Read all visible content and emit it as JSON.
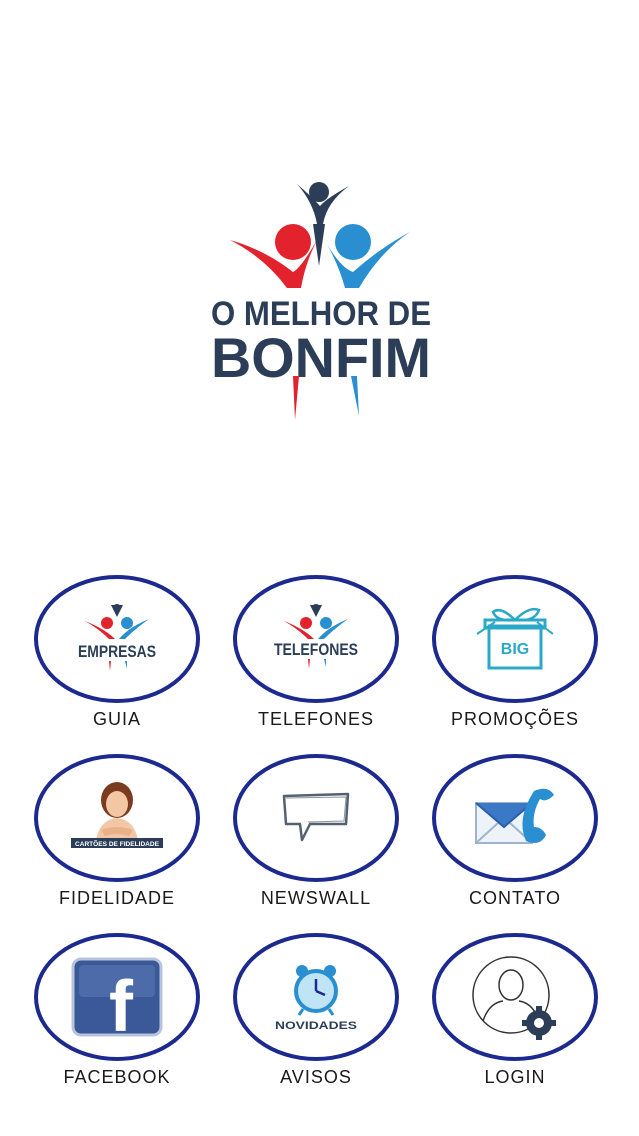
{
  "logo": {
    "line1": "O MELHOR DE",
    "line2": "BONFIM",
    "colors": {
      "red": "#e2232e",
      "blue": "#2a8fd0",
      "navy": "#2c3e57"
    }
  },
  "menu": {
    "accent": "#1c2a8f",
    "items": [
      {
        "label": "GUIA",
        "icon": "empresas-icon",
        "icon_text": "EMPRESAS"
      },
      {
        "label": "TELEFONES",
        "icon": "telefones-icon",
        "icon_text": "TELEFONES"
      },
      {
        "label": "PROMOÇÕES",
        "icon": "gift-box-icon",
        "icon_text": "BIG"
      },
      {
        "label": "FIDELIDADE",
        "icon": "loyalty-card-icon",
        "icon_text": "CARTÕES DE FIDELIDADE"
      },
      {
        "label": "NEWSWALL",
        "icon": "speech-bubble-icon"
      },
      {
        "label": "CONTATO",
        "icon": "mail-phone-icon"
      },
      {
        "label": "FACEBOOK",
        "icon": "facebook-icon",
        "icon_text": "f"
      },
      {
        "label": "AVISOS",
        "icon": "alarm-clock-icon",
        "icon_text": "NOVIDADES"
      },
      {
        "label": "LOGIN",
        "icon": "user-settings-icon"
      }
    ]
  }
}
